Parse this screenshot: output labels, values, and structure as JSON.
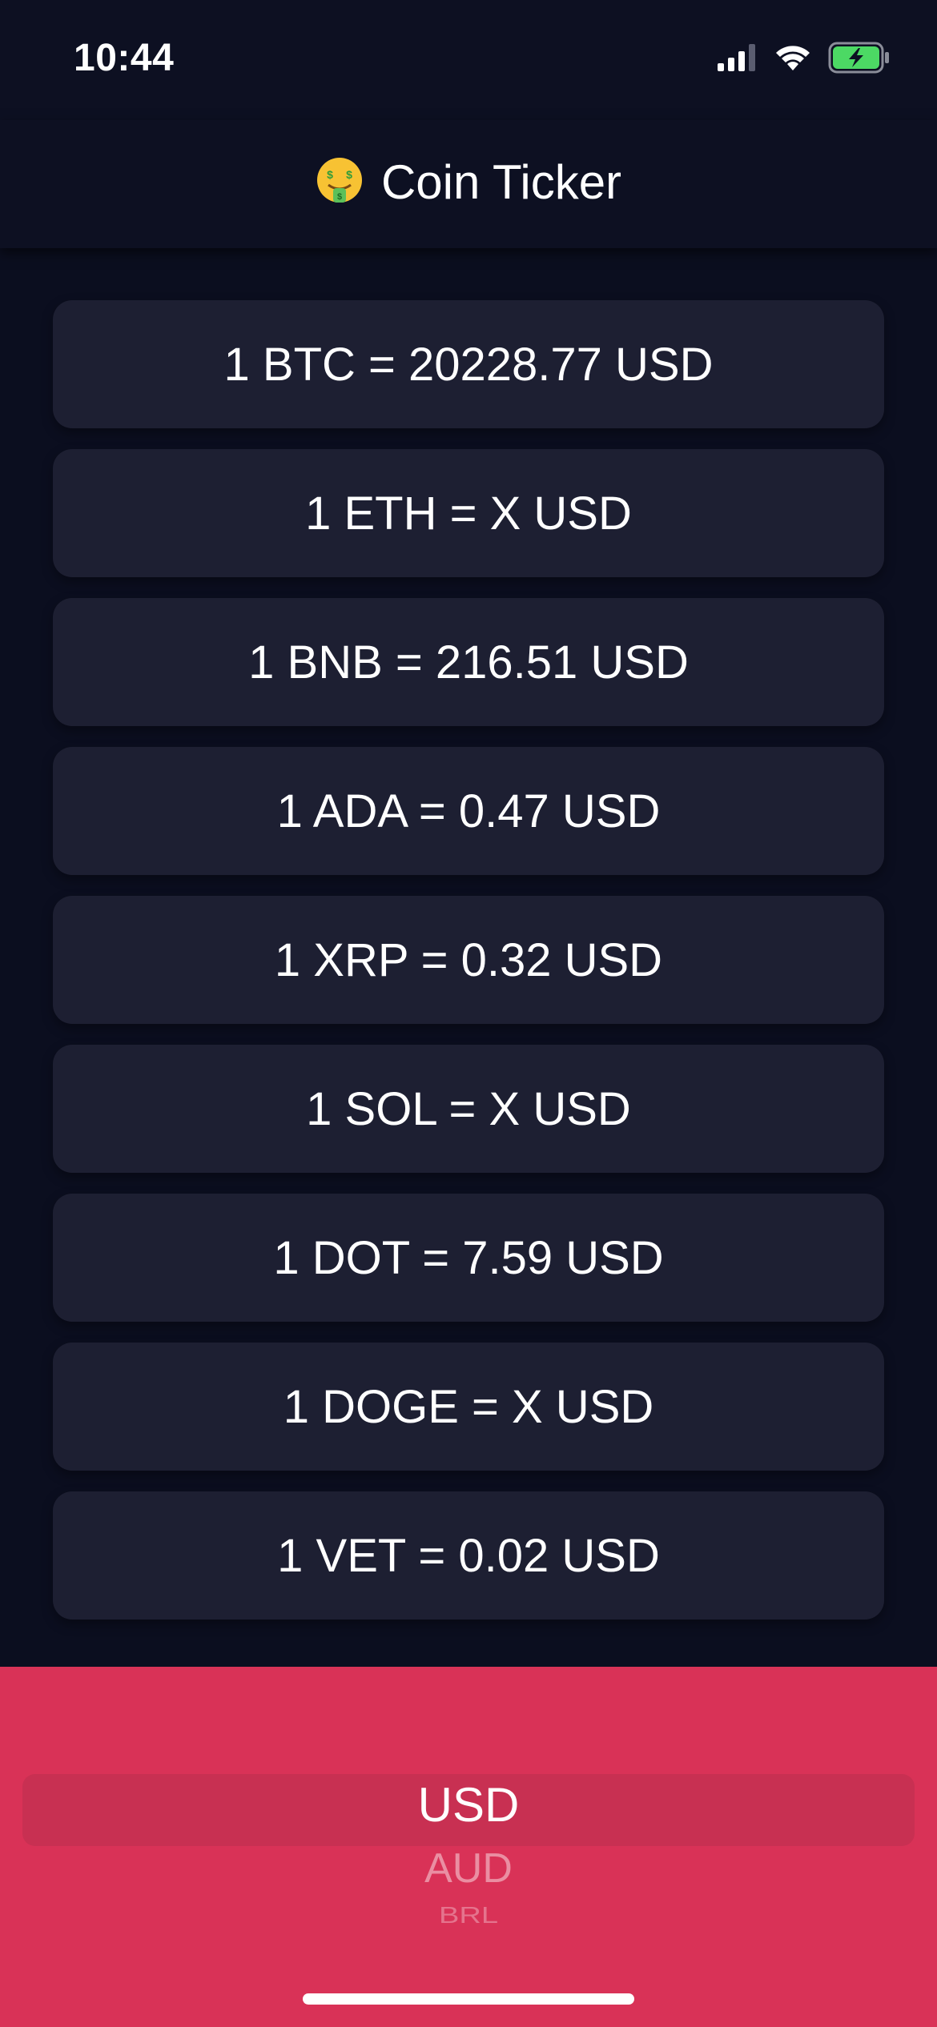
{
  "status_bar": {
    "time": "10:44"
  },
  "header": {
    "emoji": "🤑",
    "title": "Coin Ticker"
  },
  "coins": [
    {
      "label": "1 BTC = 20228.77 USD"
    },
    {
      "label": "1 ETH = X USD"
    },
    {
      "label": "1 BNB = 216.51 USD"
    },
    {
      "label": "1 ADA = 0.47 USD"
    },
    {
      "label": "1 XRP = 0.32 USD"
    },
    {
      "label": "1 SOL = X USD"
    },
    {
      "label": "1 DOT = 7.59 USD"
    },
    {
      "label": "1 DOGE = X USD"
    },
    {
      "label": "1 VET = 0.02 USD"
    }
  ],
  "currency_picker": {
    "selected": "USD",
    "options_visible": [
      "USD",
      "AUD",
      "BRL"
    ]
  },
  "colors": {
    "background": "#0b0e1f",
    "card": "#1d1f32",
    "picker_background": "#d93257",
    "battery_charging": "#4cd964"
  },
  "icons": [
    "cellular-signal-icon",
    "wifi-icon",
    "battery-charging-icon",
    "money-mouth-face-emoji"
  ]
}
